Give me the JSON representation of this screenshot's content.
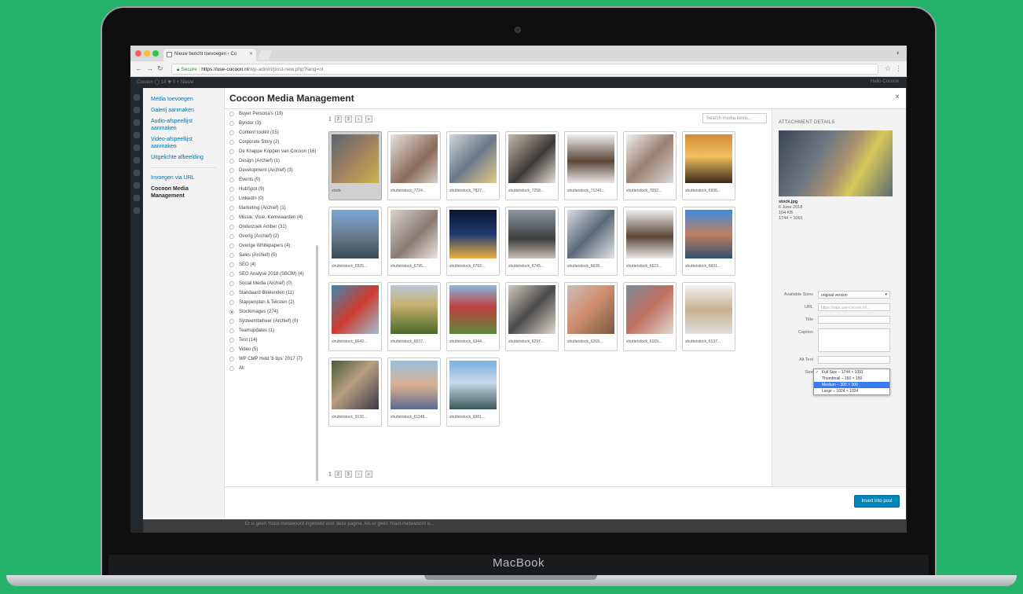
{
  "device": {
    "brand": "MacBook"
  },
  "browser": {
    "tab_title": "Nieuw bericht toevoegen ‹ Co",
    "secure_label": "Secure",
    "url_domain": "https://use-cocoon.nl",
    "url_path": "/wp-admin/post-new.php?lang=nl"
  },
  "adminbar": {
    "left": "Cocoon   ◯ 14   ✚ 0   + Nieuw",
    "right": "Hallo Cocoon"
  },
  "notice": "Er is geen Yoast-metawoord ingesteld voor deze pagina. Als er geen Yoast-metawoord is...",
  "modal": {
    "title": "Cocoon Media Management",
    "close": "×",
    "router": {
      "links": [
        "Media toevoegen",
        "Galerij aanmaken",
        "Audio-afspeellijst aanmaken",
        "Video-afspeellijst aanmaken",
        "Uitgelichte afbeelding"
      ],
      "links2": [
        "Invoegen via URL",
        "Cocoon Media Management"
      ]
    },
    "categories": [
      {
        "label": "Buyer Persona's (19)",
        "checked": false
      },
      {
        "label": "Byndor (3)",
        "checked": false
      },
      {
        "label": "Content toolkit (15)",
        "checked": false
      },
      {
        "label": "Corporate Story (2)",
        "checked": false
      },
      {
        "label": "De Knappe Koppen van Cocoon (16)",
        "checked": false
      },
      {
        "label": "Design (Archief) (1)",
        "checked": false
      },
      {
        "label": "Development (Archief) (3)",
        "checked": false
      },
      {
        "label": "Events (0)",
        "checked": false
      },
      {
        "label": "HubSpot (9)",
        "checked": false
      },
      {
        "label": "LinkedIn (0)",
        "checked": false
      },
      {
        "label": "Marketing (Archief) (1)",
        "checked": false
      },
      {
        "label": "Missie, Visie, Kernwaarden (4)",
        "checked": false
      },
      {
        "label": "Onderzoek Amber (31)",
        "checked": false
      },
      {
        "label": "Overig (Archief) (2)",
        "checked": false
      },
      {
        "label": "Overige Whitepapers (4)",
        "checked": false
      },
      {
        "label": "Sales (Archief) (0)",
        "checked": false
      },
      {
        "label": "SEO (4)",
        "checked": false
      },
      {
        "label": "SEO Analyse 2018 (SBOM) (4)",
        "checked": false
      },
      {
        "label": "Social Media (Archief) (0)",
        "checked": false
      },
      {
        "label": "Standaard Beelenden (11)",
        "checked": false
      },
      {
        "label": "Stappenplan & Teksten (2)",
        "checked": false
      },
      {
        "label": "Stockimages (274)",
        "checked": true
      },
      {
        "label": "Systeembeheer (Archief) (0)",
        "checked": false
      },
      {
        "label": "Teamupdates (1)",
        "checked": false
      },
      {
        "label": "Test (14)",
        "checked": false
      },
      {
        "label": "Video (5)",
        "checked": false
      },
      {
        "label": "WP CMP Held '8 tips' 2017 (7)",
        "checked": false
      },
      {
        "label": "All",
        "checked": false
      }
    ],
    "pager_top": {
      "current": "1",
      "buttons": [
        "2",
        "3",
        "›",
        "»"
      ]
    },
    "pager_bottom": {
      "current": "1",
      "buttons": [
        "2",
        "3",
        "›",
        "»"
      ]
    },
    "search_placeholder": "Search media items...",
    "thumbs": [
      {
        "caption": "stock",
        "selected": true,
        "color": "linear-gradient(135deg,#5a6570,#a08060 50%,#c9b44c)"
      },
      {
        "caption": "shutterstock_7724...",
        "selected": false,
        "color": "linear-gradient(135deg,#e8e2dc,#8a6a5a 60%,#d6d0ca)"
      },
      {
        "caption": "shutterstock_7827...",
        "selected": false,
        "color": "linear-gradient(135deg,#cfd6da,#6a7a8a 50%,#e6c98a)"
      },
      {
        "caption": "shutterstock_7258...",
        "selected": false,
        "color": "linear-gradient(135deg,#c7b9a6,#3e3a38 55%,#e7e2da)"
      },
      {
        "caption": "shutterstock_71241...",
        "selected": false,
        "color": "linear-gradient(180deg,#eeeeee,#5b4638 55%,#e9e9e9)"
      },
      {
        "caption": "shutterstock_7092...",
        "selected": false,
        "color": "linear-gradient(135deg,#f0f0f0,#9a8070 50%,#d8d8d8)"
      },
      {
        "caption": "shutterstock_6936...",
        "selected": false,
        "color": "linear-gradient(180deg,#d48a3a,#f0c060 45%,#3a2a1a)"
      },
      {
        "caption": "shutterstock_6925...",
        "selected": false,
        "color": "linear-gradient(180deg,#7aa6d6,#6a7e90 50%,#3a4a55)"
      },
      {
        "caption": "shutterstock_6795...",
        "selected": false,
        "color": "linear-gradient(135deg,#d8d2cc,#8a7a70 55%,#ece7e2)"
      },
      {
        "caption": "shutterstock_6792...",
        "selected": false,
        "color": "linear-gradient(180deg,#0b1530,#1d3a70 50%,#f0b040)"
      },
      {
        "caption": "shutterstock_6745...",
        "selected": false,
        "color": "linear-gradient(180deg,#8a97a5,#3e3e3e 60%,#c9c0b4)"
      },
      {
        "caption": "shutterstock_6638...",
        "selected": false,
        "color": "linear-gradient(135deg,#d6dde5,#5a6a7a 50%,#e5e5e5)"
      },
      {
        "caption": "shutterstock_6623...",
        "selected": false,
        "color": "linear-gradient(180deg,#eeeeee,#5b4638 55%,#e9e9e9)"
      },
      {
        "caption": "shutterstock_6601...",
        "selected": false,
        "color": "linear-gradient(180deg,#3d8be0,#c08060 50%,#2f5070)"
      },
      {
        "caption": "shutterstock_6649...",
        "selected": false,
        "color": "linear-gradient(135deg,#3a8ab0,#d03a30 50%,#9ac0d0)"
      },
      {
        "caption": "shutterstock_6637...",
        "selected": false,
        "color": "linear-gradient(180deg,#b8c8d8,#c8b070 40%,#4a6a2a)"
      },
      {
        "caption": "shutterstock_6344...",
        "selected": false,
        "color": "linear-gradient(180deg,#88b8e0,#c04040 45%,#5a8a3a)"
      },
      {
        "caption": "shutterstock_6297...",
        "selected": false,
        "color": "linear-gradient(135deg,#d0c8c0,#4a4a4a 50%,#e0dad0)"
      },
      {
        "caption": "shutterstock_6269...",
        "selected": false,
        "color": "linear-gradient(135deg,#c8c0b8,#d09070 45%,#7a5a40)"
      },
      {
        "caption": "shutterstock_6169...",
        "selected": false,
        "color": "linear-gradient(135deg,#7a8a9a,#c07060 50%,#e0d8d0)"
      },
      {
        "caption": "shutterstock_6137...",
        "selected": false,
        "color": "linear-gradient(180deg,#f2f2f2,#c8b090 50%,#e0e0e0)"
      },
      {
        "caption": "shutterstock_6130...",
        "selected": false,
        "color": "linear-gradient(135deg,#4a5a3a,#b8a080 45%,#3a3a4a)"
      },
      {
        "caption": "shutterstock_61148...",
        "selected": false,
        "color": "linear-gradient(180deg,#9ac0e0,#d8b090 50%,#5a6a90)"
      },
      {
        "caption": "shutterstock_6081...",
        "selected": false,
        "color": "linear-gradient(180deg,#7ab0e0,#c8d8e8 45%,#3a5a5a)"
      }
    ],
    "details": {
      "title": "ATTACHMENT DETAILS",
      "filename": "stock.jpg",
      "date": "6 June 2018",
      "filesize": "104 KB",
      "dimensions": "1744 × 1091",
      "fields": {
        "available_sizes_label": "Available Sizes",
        "available_sizes_value": "original version",
        "url_label": "URL",
        "url_value": "https://sapi.use-cocoon.nl/...",
        "title_label": "Title",
        "caption_label": "Caption",
        "alt_label": "Alt Text",
        "size_label": "Size"
      },
      "size_options": [
        {
          "label": "Full Size – 1744 × 1091",
          "checked": true,
          "highlight": false
        },
        {
          "label": "Thumbnail – 150 × 150",
          "checked": false,
          "highlight": false
        },
        {
          "label": "Medium – 300 × 300",
          "checked": false,
          "highlight": true
        },
        {
          "label": "Large – 1024 × 1024",
          "checked": false,
          "highlight": false
        }
      ]
    },
    "insert_button": "Insert into post"
  }
}
